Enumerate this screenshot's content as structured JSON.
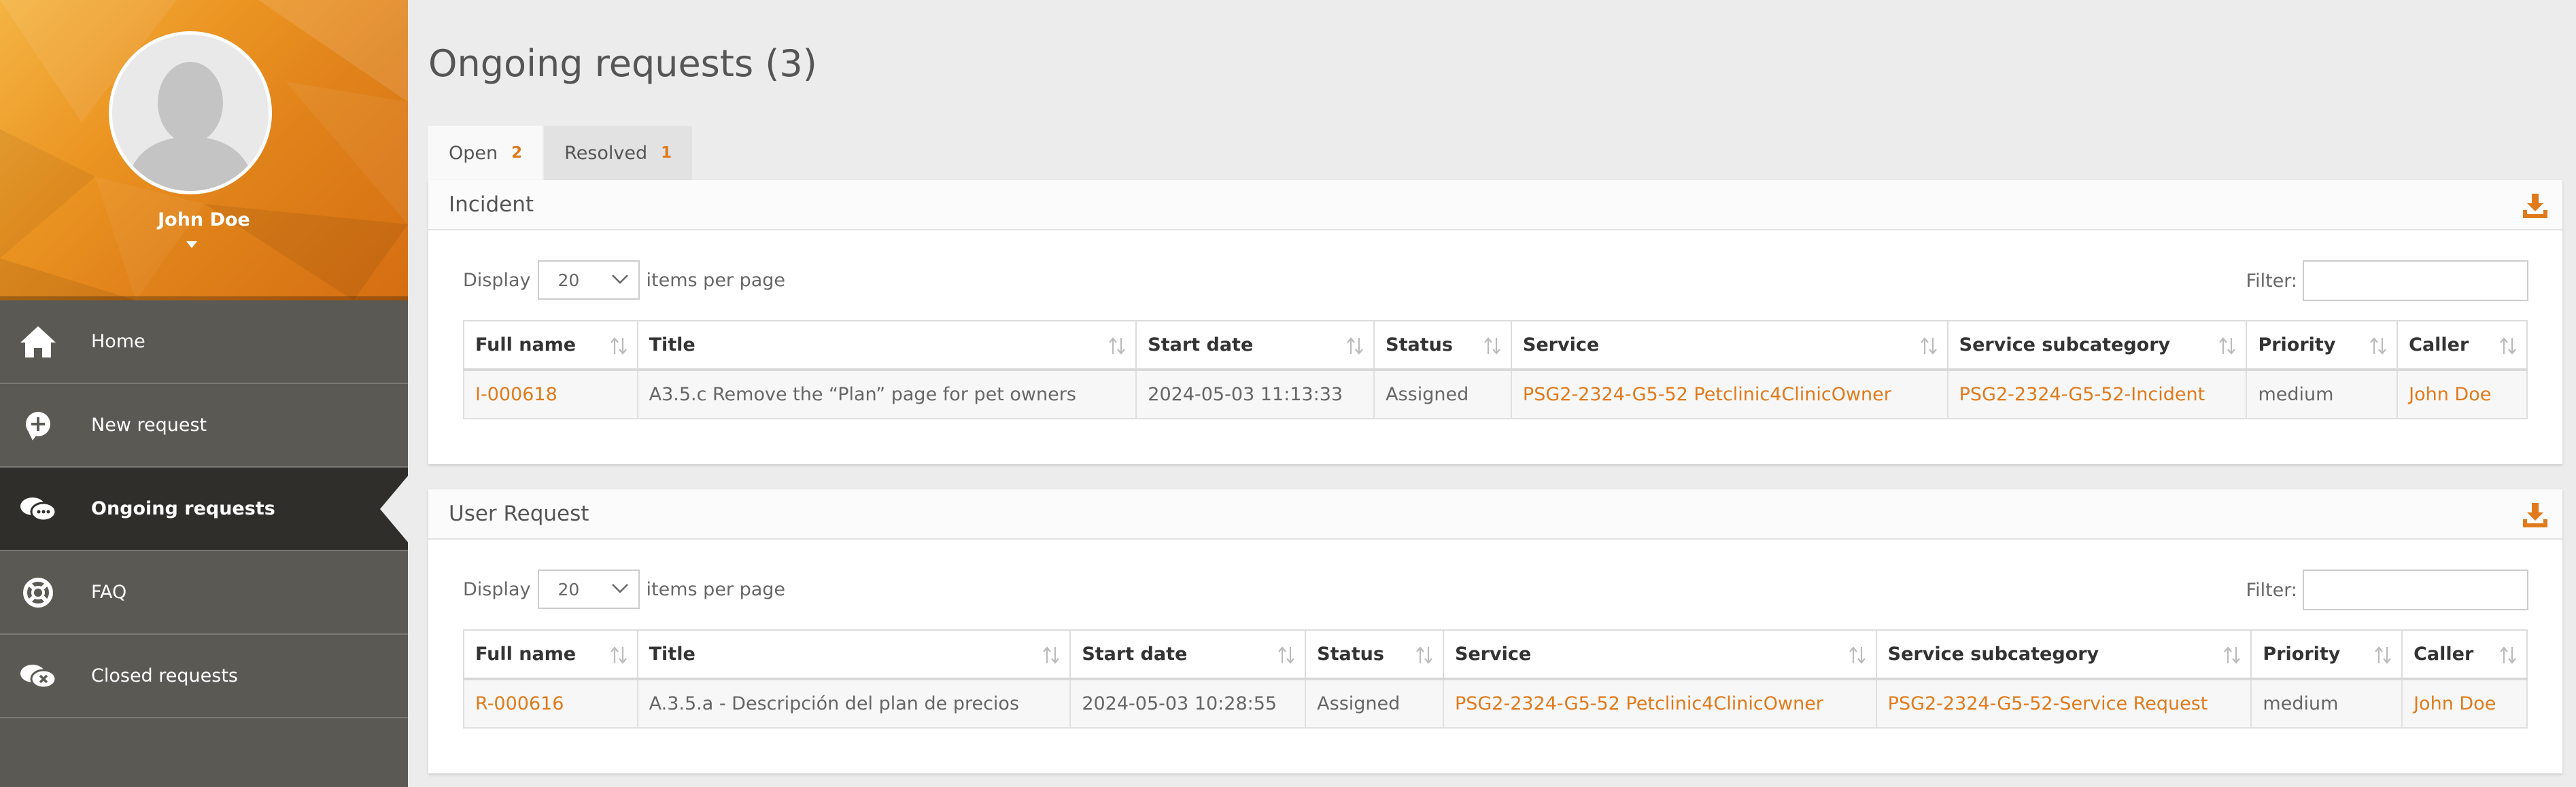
{
  "user": {
    "name": "John Doe"
  },
  "nav": [
    {
      "label": "Home",
      "icon": "home-icon",
      "active": false
    },
    {
      "label": "New request",
      "icon": "plus-icon",
      "active": false
    },
    {
      "label": "Ongoing requests",
      "icon": "chat-bubbles-icon",
      "active": true
    },
    {
      "label": "FAQ",
      "icon": "lifebuoy-icon",
      "active": false
    },
    {
      "label": "Closed requests",
      "icon": "closed-chat-icon",
      "active": false
    }
  ],
  "page": {
    "title": "Ongoing requests (3)"
  },
  "tabs": [
    {
      "label": "Open",
      "count": "2"
    },
    {
      "label": "Resolved",
      "count": "1"
    }
  ],
  "controls": {
    "display_label": "Display",
    "per_page": "20",
    "per_page_suffix": "items per page",
    "filter_label": "Filter:"
  },
  "incident": {
    "title": "Incident",
    "columns": [
      "Full name",
      "Title",
      "Start date",
      "Status",
      "Service",
      "Service subcategory",
      "Priority",
      "Caller"
    ],
    "rows": [
      [
        "I-000618",
        "A3.5.c Remove the “Plan” page for pet owners",
        "2024-05-03 11:13:33",
        "Assigned",
        "PSG2-2324-G5-52 Petclinic4ClinicOwner",
        "PSG2-2324-G5-52-Incident",
        "medium",
        "John Doe"
      ]
    ]
  },
  "user_request": {
    "title": "User Request",
    "columns": [
      "Full name",
      "Title",
      "Start date",
      "Status",
      "Service",
      "Service subcategory",
      "Priority",
      "Caller"
    ],
    "rows": [
      [
        "R-000616",
        "A.3.5.a - Descripción del plan de precios",
        "2024-05-03 10:28:55",
        "Assigned",
        "PSG2-2324-G5-52 Petclinic4ClinicOwner",
        "PSG2-2324-G5-52-Service Request",
        "medium",
        "John Doe"
      ]
    ]
  },
  "colors": {
    "accent": "#e07a1b",
    "sidebar": "#5a5954",
    "sidebar_active": "#2f2e2b",
    "background": "#ececec"
  }
}
